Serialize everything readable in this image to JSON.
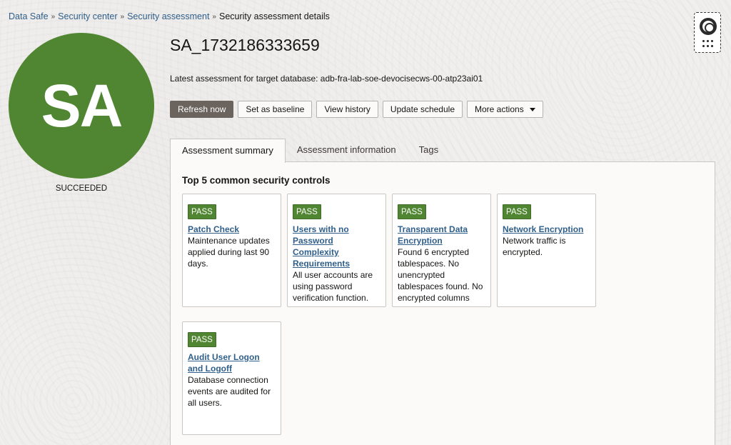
{
  "breadcrumb": {
    "items": [
      "Data Safe",
      "Security center",
      "Security assessment"
    ],
    "current": "Security assessment details"
  },
  "avatar": {
    "initials": "SA",
    "color": "#508631"
  },
  "status": "SUCCEEDED",
  "title": "SA_1732186333659",
  "subtitle": "Latest assessment for target database: adb-fra-lab-soe-devocisecws-00-atp23ai01",
  "actions": {
    "refresh": "Refresh now",
    "baseline": "Set as baseline",
    "history": "View history",
    "schedule": "Update schedule",
    "more": "More actions"
  },
  "tabs": [
    "Assessment summary",
    "Assessment information",
    "Tags"
  ],
  "panel": {
    "heading": "Top 5 common security controls",
    "cards": [
      {
        "badge": "PASS",
        "title": "Patch Check",
        "desc": "Maintenance updates applied during last 90 days."
      },
      {
        "badge": "PASS",
        "title": "Users with no Password Complexity Requirements",
        "desc": "All user accounts are using password verification function."
      },
      {
        "badge": "PASS",
        "title": "Transparent Data Encryption",
        "desc": "Found 6 encrypted tablespaces. No unencrypted tablespaces found. No encrypted columns"
      },
      {
        "badge": "PASS",
        "title": "Network Encryption",
        "desc": "Network traffic is encrypted."
      },
      {
        "badge": "PASS",
        "title": "Audit User Logon and Logoff",
        "desc": "Database connection events are audited for all users."
      }
    ]
  },
  "colors": {
    "pass": "#508631",
    "link": "#2f5f8a",
    "primary_button": "#6b635d"
  }
}
